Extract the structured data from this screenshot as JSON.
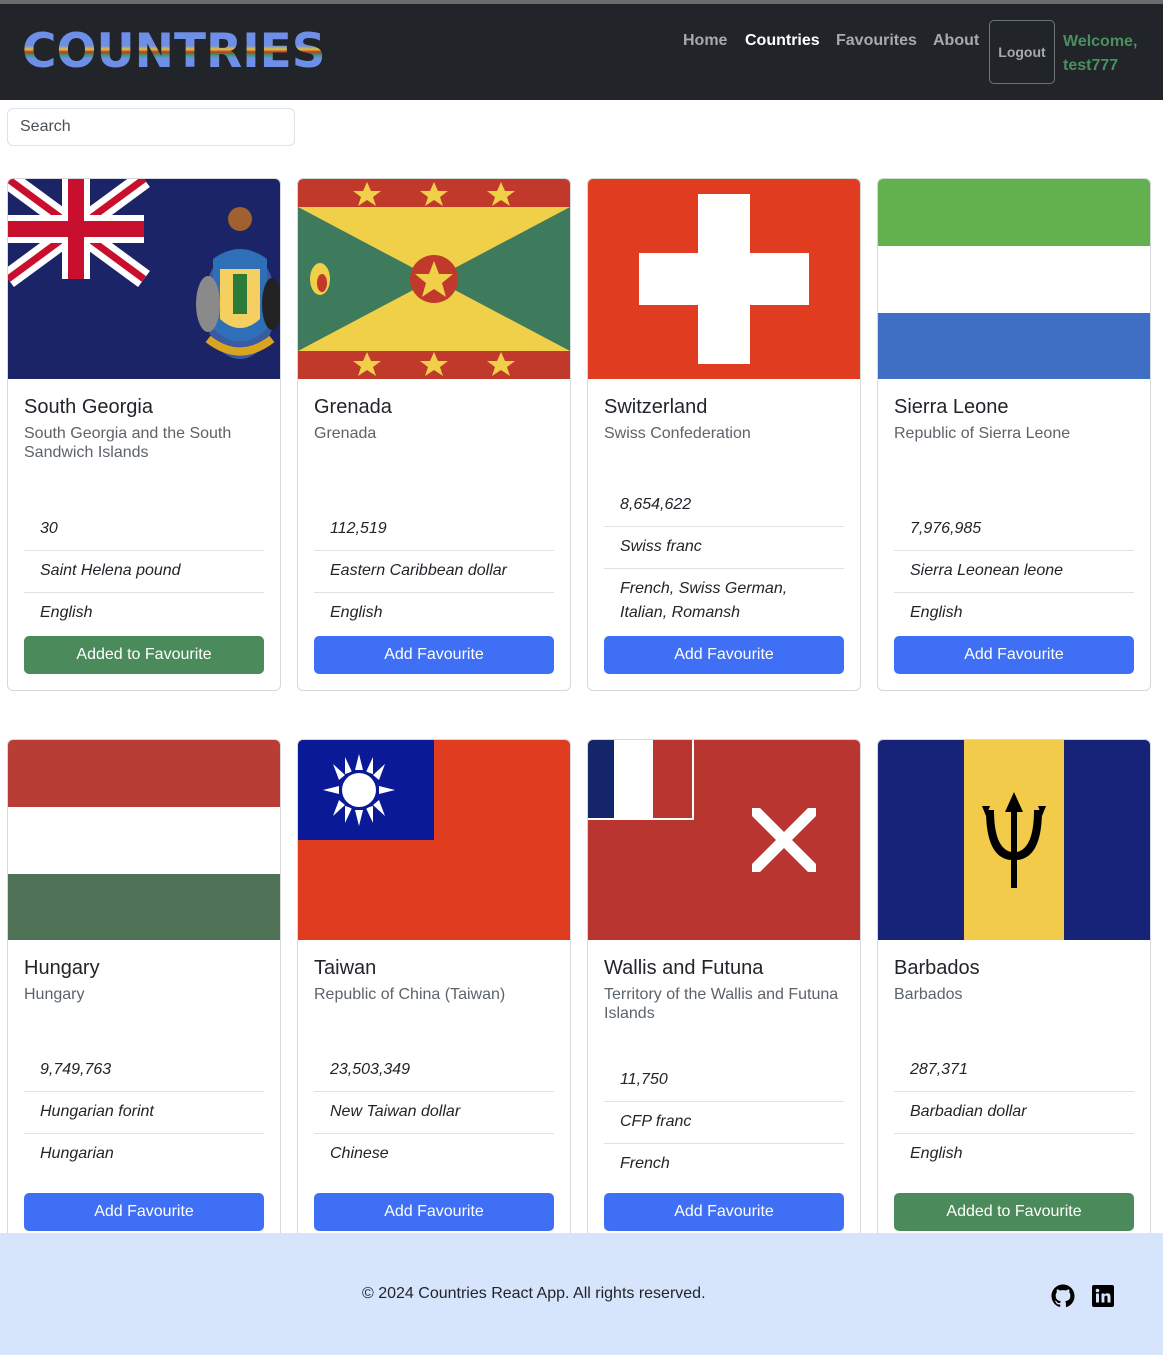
{
  "header": {
    "brand": "COUNTRIES",
    "nav": [
      "Home",
      "Countries",
      "Favourites",
      "About"
    ],
    "active_nav": "Countries",
    "logout_label": "Logout",
    "welcome_text": "Welcome, test777"
  },
  "search": {
    "placeholder": "Search",
    "value": ""
  },
  "countries": [
    {
      "name": "South Georgia",
      "official": "South Georgia and the South Sandwich Islands",
      "population": "30",
      "currency": "Saint Helena pound",
      "languages": "English",
      "button": "Added to Favourite",
      "favourite": true,
      "flag": "south-georgia-flag"
    },
    {
      "name": "Grenada",
      "official": "Grenada",
      "population": "112,519",
      "currency": "Eastern Caribbean dollar",
      "languages": "English",
      "button": "Add Favourite",
      "favourite": false,
      "flag": "grenada-flag"
    },
    {
      "name": "Switzerland",
      "official": "Swiss Confederation",
      "population": "8,654,622",
      "currency": "Swiss franc",
      "languages": "French, Swiss German, Italian, Romansh",
      "button": "Add Favourite",
      "favourite": false,
      "flag": "switzerland-flag"
    },
    {
      "name": "Sierra Leone",
      "official": "Republic of Sierra Leone",
      "population": "7,976,985",
      "currency": "Sierra Leonean leone",
      "languages": "English",
      "button": "Add Favourite",
      "favourite": false,
      "flag": "sierra-leone-flag"
    },
    {
      "name": "Hungary",
      "official": "Hungary",
      "population": "9,749,763",
      "currency": "Hungarian forint",
      "languages": "Hungarian",
      "button": "Add Favourite",
      "favourite": false,
      "flag": "hungary-flag"
    },
    {
      "name": "Taiwan",
      "official": "Republic of China (Taiwan)",
      "population": "23,503,349",
      "currency": "New Taiwan dollar",
      "languages": "Chinese",
      "button": "Add Favourite",
      "favourite": false,
      "flag": "taiwan-flag"
    },
    {
      "name": "Wallis and Futuna",
      "official": "Territory of the Wallis and Futuna Islands",
      "population": "11,750",
      "currency": "CFP franc",
      "languages": "French",
      "button": "Add Favourite",
      "favourite": false,
      "flag": "wallis-futuna-flag"
    },
    {
      "name": "Barbados",
      "official": "Barbados",
      "population": "287,371",
      "currency": "Barbadian dollar",
      "languages": "English",
      "button": "Added to Favourite",
      "favourite": true,
      "flag": "barbados-flag"
    }
  ],
  "footer": {
    "copyright": "© 2024 Countries React App. All rights reserved.",
    "icons": [
      "github-icon",
      "linkedin-icon"
    ]
  },
  "colors": {
    "navbar": "#212529",
    "primary_button": "#3f6ff5",
    "added_button": "#4b8a5a",
    "footer": "#d6e4fc",
    "welcome": "#4a8f5e"
  }
}
